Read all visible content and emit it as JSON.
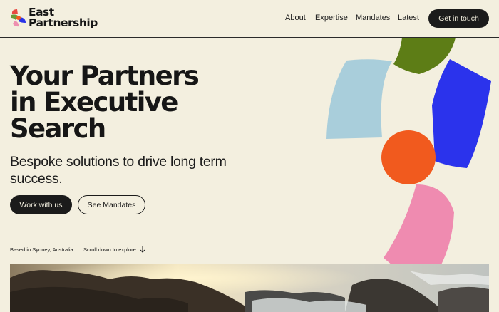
{
  "brand": {
    "name_line1": "East",
    "name_line2": "Partnership",
    "colors": {
      "red": "#e8483f",
      "green": "#6a9a37",
      "blue": "#2933e8",
      "pink": "#ee8fb0"
    }
  },
  "nav": {
    "links": [
      "About",
      "Expertise",
      "Mandates",
      "Latest"
    ],
    "cta": "Get in touch"
  },
  "hero": {
    "title_lines": [
      "Your Partners",
      "in Executive",
      "Search"
    ],
    "subtitle": "Bespoke solutions to drive long term success.",
    "primary_button": "Work with us",
    "secondary_button": "See Mandates",
    "location": "Based in Sydney, Australia",
    "scroll_hint": "Scroll down to explore"
  },
  "shapes": {
    "colors": {
      "light_blue": "#a9cedb",
      "olive": "#5d7d16",
      "blue": "#2b33ec",
      "orange": "#f15a1e",
      "pink": "#ef8bb0"
    }
  },
  "icons": {
    "scroll": "arrow-down-icon"
  }
}
